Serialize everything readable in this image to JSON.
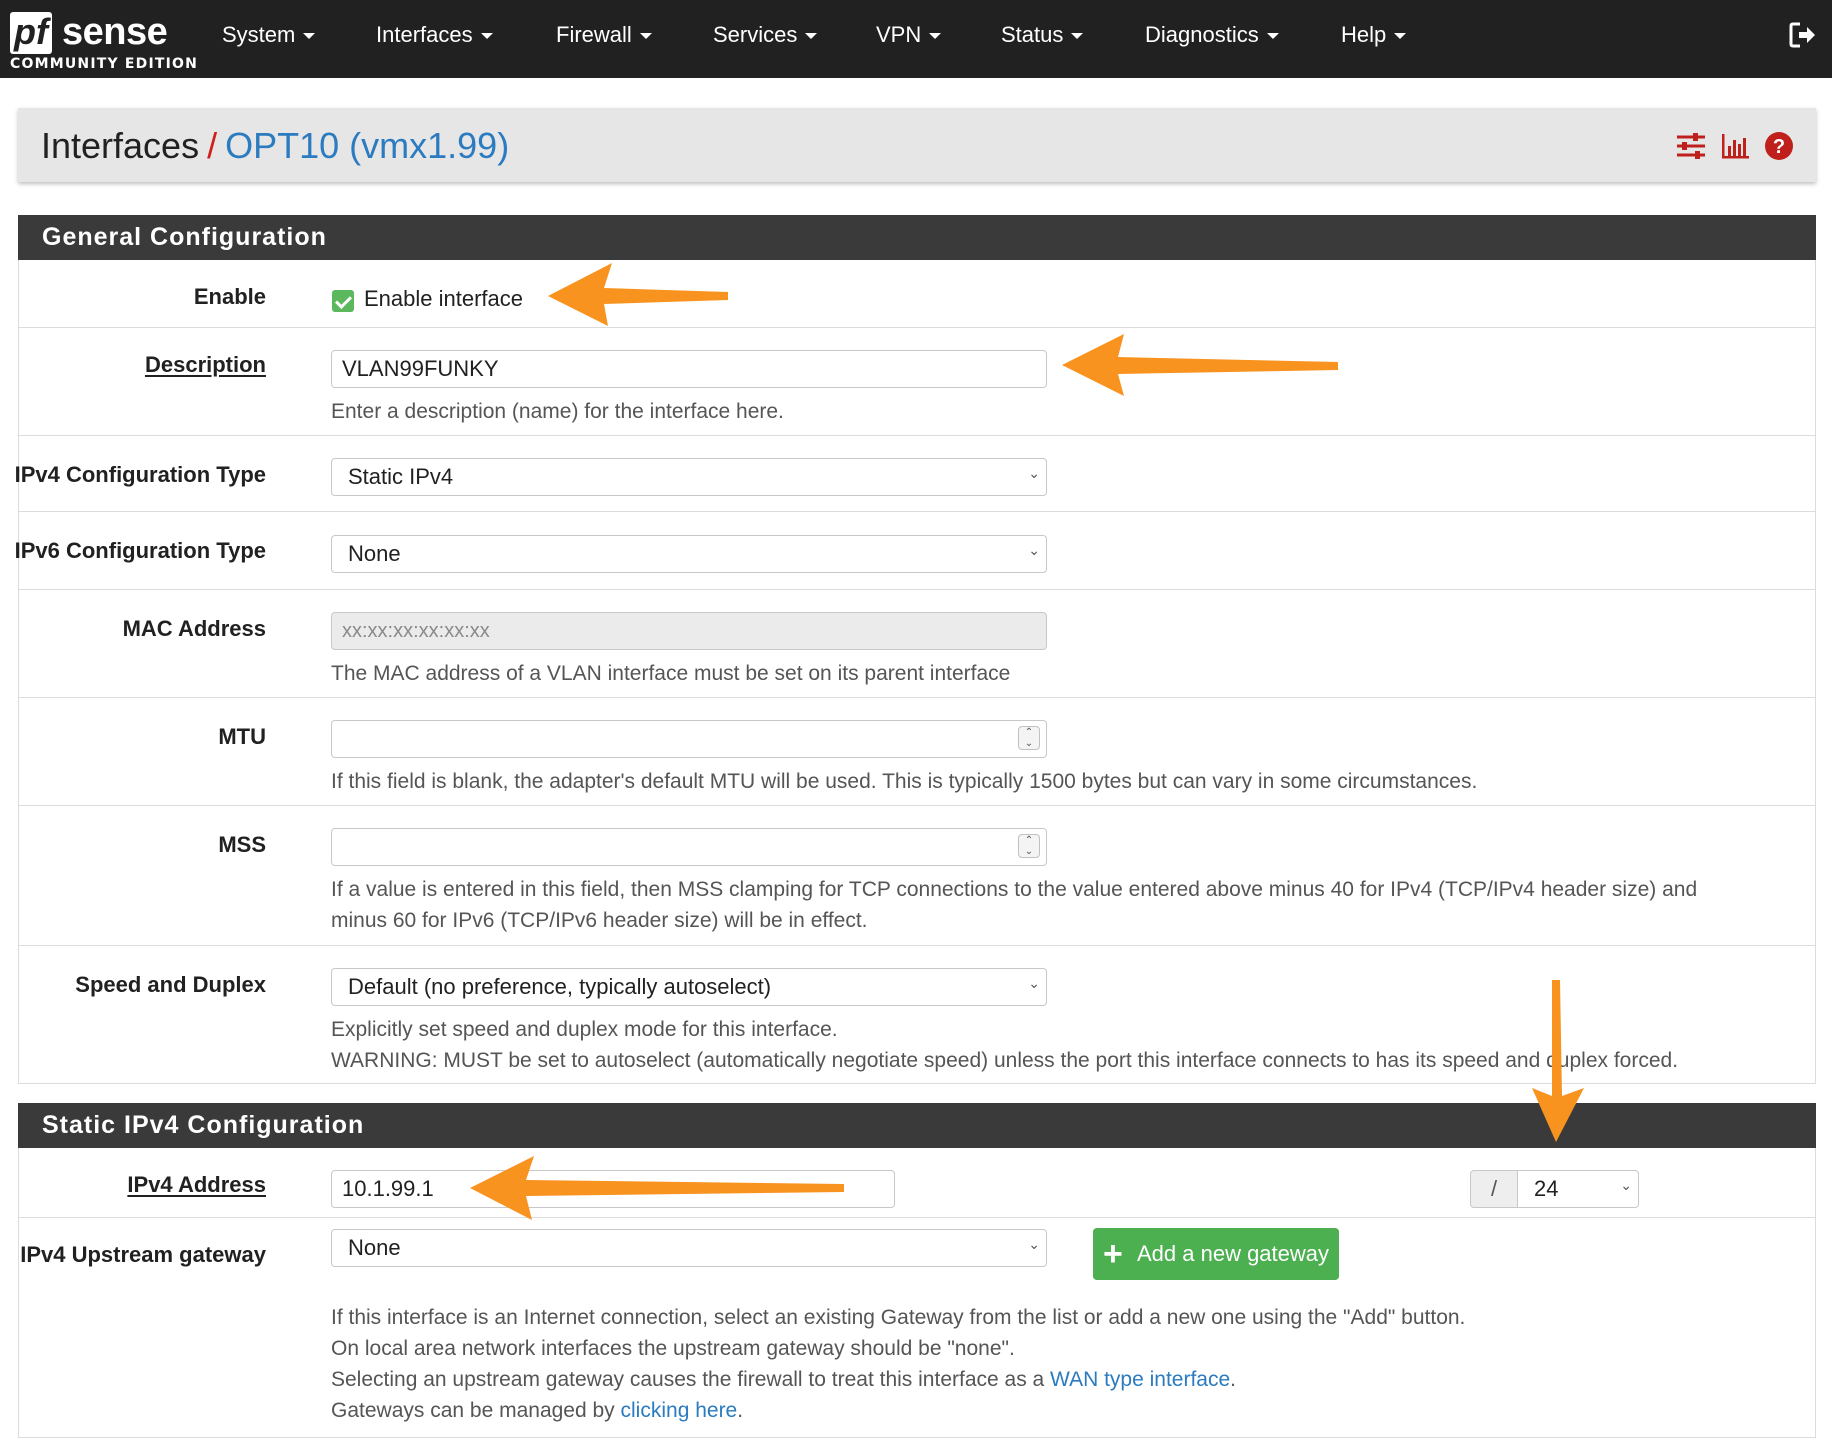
{
  "nav": {
    "logo_main": "pf",
    "logo_sense": "sense",
    "logo_edition": "COMMUNITY EDITION",
    "items": [
      "System",
      "Interfaces",
      "Firewall",
      "Services",
      "VPN",
      "Status",
      "Diagnostics",
      "Help"
    ],
    "logout_icon": "sign-out-icon"
  },
  "breadcrumb": {
    "section": "Interfaces",
    "separator": "/",
    "current": "OPT10 (vmx1.99)",
    "icons": [
      "sliders-icon",
      "bar-chart-icon",
      "question-circle-icon"
    ]
  },
  "general": {
    "title": "General Configuration",
    "enable": {
      "label": "Enable",
      "checkbox_label": "Enable interface",
      "checked": true
    },
    "description": {
      "label": "Description",
      "value": "VLAN99FUNKY",
      "help": "Enter a description (name) for the interface here."
    },
    "ipv4_type": {
      "label": "IPv4 Configuration Type",
      "value": "Static IPv4"
    },
    "ipv6_type": {
      "label": "IPv6 Configuration Type",
      "value": "None"
    },
    "mac": {
      "label": "MAC Address",
      "placeholder": "xx:xx:xx:xx:xx:xx",
      "help": "The MAC address of a VLAN interface must be set on its parent interface"
    },
    "mtu": {
      "label": "MTU",
      "value": "",
      "help": "If this field is blank, the adapter's default MTU will be used. This is typically 1500 bytes but can vary in some circumstances."
    },
    "mss": {
      "label": "MSS",
      "value": "",
      "help_line1": "If a value is entered in this field, then MSS clamping for TCP connections to the value entered above minus 40 for IPv4 (TCP/IPv4 header size) and",
      "help_line2": "minus 60 for IPv6 (TCP/IPv6 header size) will be in effect."
    },
    "speed": {
      "label": "Speed and Duplex",
      "value": "Default (no preference, typically autoselect)",
      "help_line1": "Explicitly set speed and duplex mode for this interface.",
      "help_line2": "WARNING: MUST be set to autoselect (automatically negotiate speed) unless the port this interface connects to has its speed and duplex forced."
    }
  },
  "static_ipv4": {
    "title": "Static IPv4 Configuration",
    "address": {
      "label": "IPv4 Address",
      "value": "10.1.99.1",
      "slash": "/",
      "prefix": "24"
    },
    "gateway": {
      "label": "IPv4 Upstream gateway",
      "value": "None",
      "add_button": "Add a new gateway",
      "help_line1": "If this interface is an Internet connection, select an existing Gateway from the list or add a new one using the \"Add\" button.",
      "help_line2": "On local area network interfaces the upstream gateway should be \"none\".",
      "help_line3_pre": "Selecting an upstream gateway causes the firewall to treat this interface as a ",
      "help_line3_link": "WAN type interface",
      "help_line3_post": ".",
      "help_line4_pre": "Gateways can be managed by ",
      "help_line4_link": "clicking here",
      "help_line4_post": "."
    }
  },
  "annotation_color": "#f7931e"
}
